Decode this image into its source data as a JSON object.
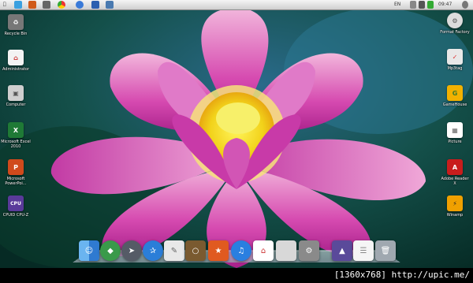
{
  "menubar": {
    "input_lang": "EN",
    "clock": "09:47",
    "icons": [
      "apple-icon",
      "color-icon",
      "hammer-icon",
      "chrome-icon",
      "network-icon",
      "word-icon",
      "user-icon",
      "volume-icon",
      "battery-icon",
      "settings-icon"
    ]
  },
  "desktop_left": [
    {
      "label": "Recycle Bin",
      "icon": "recycle-bin-icon",
      "color": "#777777"
    },
    {
      "label": "Administrator",
      "icon": "home-folder-icon",
      "color": "#ffffff"
    },
    {
      "label": "Computer",
      "icon": "computer-icon",
      "color": "#cfcfcf"
    },
    {
      "label": "Microsoft Excel 2010",
      "icon": "excel-icon",
      "color": "#1f7a36"
    },
    {
      "label": "Microsoft PowerPoi...",
      "icon": "powerpoint-icon",
      "color": "#d04a1c"
    },
    {
      "label": "CPUID CPU-Z",
      "icon": "cpu-z-icon",
      "color": "#5a3a9a"
    }
  ],
  "desktop_right": [
    {
      "label": "Format Factory",
      "icon": "format-factory-icon",
      "color": "#dcdcdc"
    },
    {
      "label": "Mp3tag",
      "icon": "mp3tag-icon",
      "color": "#e8e8e8"
    },
    {
      "label": "GameHouse",
      "icon": "gamehouse-icon",
      "color": "#f2b100"
    },
    {
      "label": "Picture",
      "icon": "picture-folder-icon",
      "color": "#ffffff"
    },
    {
      "label": "Adobe Reader X",
      "icon": "adobe-reader-icon",
      "color": "#c81d1d"
    },
    {
      "label": "Winamp",
      "icon": "winamp-icon",
      "color": "#f0a000"
    }
  ],
  "dock": [
    {
      "name": "finder-icon",
      "color": "#3c8fd8"
    },
    {
      "name": "sims-icon",
      "color": "#3a9a4a"
    },
    {
      "name": "rocket-launcher-icon",
      "color": "#555b66"
    },
    {
      "name": "safari-icon",
      "color": "#2b7ed8"
    },
    {
      "name": "documents-icon",
      "color": "#e8e8e8"
    },
    {
      "name": "photos-icon",
      "color": "#7a5a30"
    },
    {
      "name": "subway-surfers-icon",
      "color": "#e05a20"
    },
    {
      "name": "itunes-icon",
      "color": "#2a7fe0"
    },
    {
      "name": "home-icon",
      "color": "#ffffff"
    },
    {
      "name": "blank-app-icon",
      "color": "#d8d8d8"
    },
    {
      "name": "system-preferences-icon",
      "color": "#8a8a8a"
    },
    {
      "name": "desktop-folder-icon",
      "color": "#5a4a9a"
    },
    {
      "name": "document-icon",
      "color": "#f5f5f5"
    },
    {
      "name": "trash-icon",
      "color": "#a0a8b0"
    }
  ],
  "watermark": "[1360x768] http://upic.me/"
}
